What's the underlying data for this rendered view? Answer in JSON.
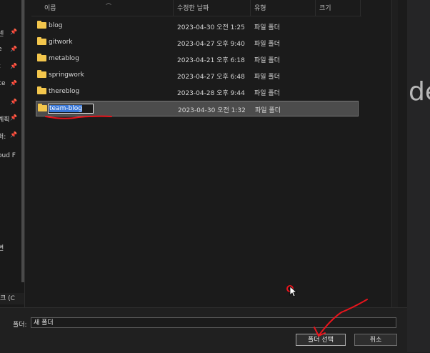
{
  "nav": {
    "items": [
      {
        "label": "센",
        "pinned": true
      },
      {
        "label": "e",
        "pinned": true
      },
      {
        "label": "t",
        "pinned": true
      },
      {
        "label": "ce",
        "pinned": true
      },
      {
        "label": "",
        "pinned": true
      },
      {
        "label": "계획",
        "pinned": true
      },
      {
        "label": "퍼:",
        "pinned": true
      },
      {
        "label": "oud F",
        "pinned": false
      },
      {
        "label": "변",
        "pinned": false
      }
    ],
    "bottom_label": "크 (C"
  },
  "columns": {
    "name": "이름",
    "modified": "수정한 날짜",
    "type": "유형",
    "size": "크기"
  },
  "files": [
    {
      "name": "blog",
      "modified": "2023-04-30 오전 1:25",
      "type": "파일 폴더",
      "size": ""
    },
    {
      "name": "gitwork",
      "modified": "2023-04-27 오후 9:40",
      "type": "파일 폴더",
      "size": ""
    },
    {
      "name": "metablog",
      "modified": "2023-04-21 오후 6:18",
      "type": "파일 폴더",
      "size": ""
    },
    {
      "name": "springwork",
      "modified": "2023-04-27 오후 6:48",
      "type": "파일 폴더",
      "size": ""
    },
    {
      "name": "thereblog",
      "modified": "2023-04-28 오후 9:44",
      "type": "파일 폴더",
      "size": ""
    },
    {
      "name": "team-blog",
      "modified": "2023-04-30 오전 1:32",
      "type": "파일 폴더",
      "size": "",
      "selected": true,
      "renaming": true
    }
  ],
  "footer": {
    "folder_label": "폴더:",
    "folder_value": "새 폴더",
    "select_button": "폴더 선택",
    "cancel_button": "취소"
  },
  "background": {
    "text": "de"
  },
  "colors": {
    "folder": "#f3c64c",
    "annotation": "#e8141c",
    "selection": "#4c4c4c"
  }
}
